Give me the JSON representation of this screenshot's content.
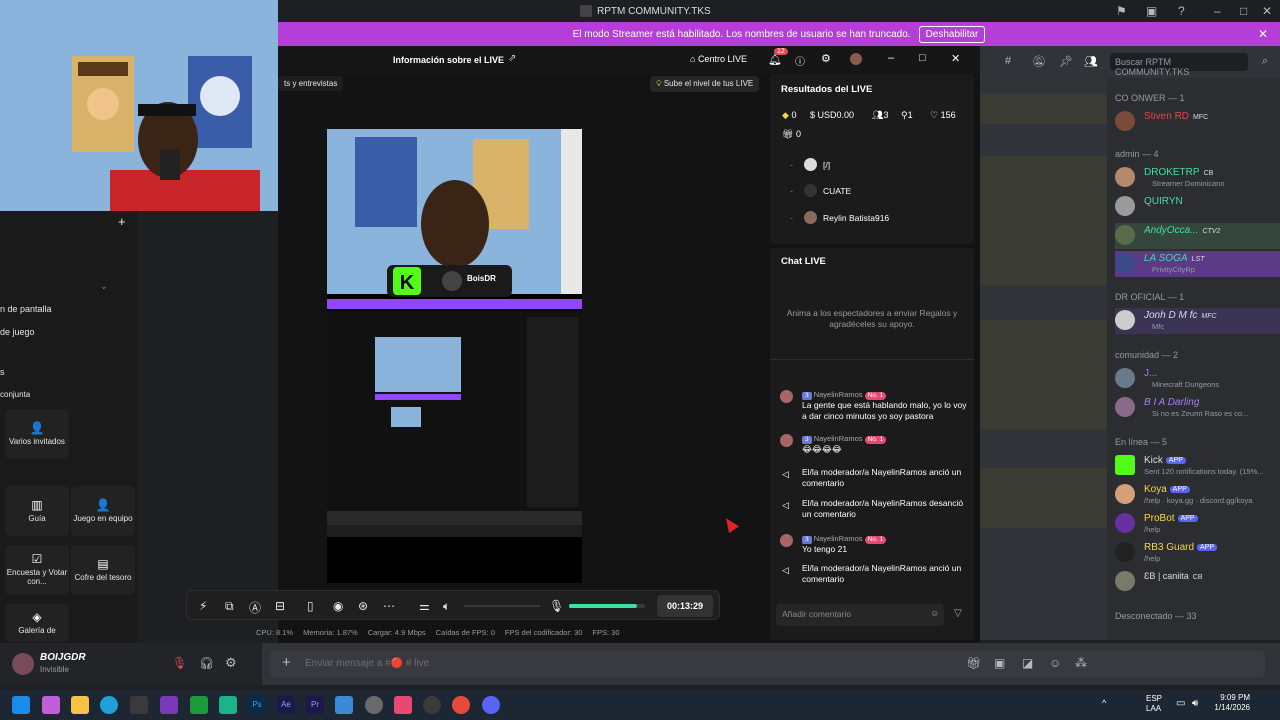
{
  "window": {
    "title": "RPTM COMMUNITY.TKS"
  },
  "banner": {
    "text": "El modo Streamer está habilitado. Los nombres de usuario se han truncado.",
    "button": "Deshabilitar"
  },
  "studio": {
    "header_title": "Información sobre el LIVE",
    "center_live": "Centro LIVE",
    "notif_count": "12",
    "tag_text": "ts y entrevistas",
    "level_tip": "Sube el nivel de tus LIVE",
    "timer": "00:13:29",
    "volume_level": 0.9,
    "preview_user": "BoisDR"
  },
  "left_panel": {
    "items": [
      "n de pantalla",
      "de juego",
      "s",
      "conjunta"
    ],
    "tiles": [
      {
        "label": "Varios invitados",
        "icon": "users-icon"
      },
      {
        "label": "Guía",
        "icon": "book-icon"
      },
      {
        "label": "Juego en equipo",
        "icon": "team-icon"
      },
      {
        "label": "Encuesta y Votar con...",
        "icon": "poll-icon"
      },
      {
        "label": "Cofre del tesoro",
        "icon": "chest-icon"
      },
      {
        "label": "Galería de",
        "icon": "gallery-icon"
      }
    ]
  },
  "stats_bar": {
    "cpu": "CPU: 8.1%",
    "mem": "Memoria: 1.87%",
    "load": "Cargar: 4.9 Mbps",
    "fps_drop": "Caídas de FPS: 0",
    "enc_fps": "FPS del codificador: 30",
    "fps": "FPS: 30"
  },
  "results": {
    "title": "Resultados del LIVE",
    "diamonds": "0",
    "usd": "USD0.00",
    "viewers": "3",
    "shares": "1",
    "likes": "156",
    "gifts": "0",
    "viewers_list": [
      "[/]",
      "CUATE",
      "Reylin Batista916"
    ]
  },
  "chat": {
    "title": "Chat LIVE",
    "empty_text": "Anima a los espectadores a enviar Regalos y agradéceles su apoyo.",
    "messages": [
      {
        "name": "NayelinRamos",
        "level": "3",
        "rank": "No. 1",
        "text": "La gente que está hablando malo, yo lo voy a dar cinco minutos yo soy pastora"
      },
      {
        "name": "NayelinRamos",
        "level": "3",
        "rank": "No. 1",
        "text": "😂😂😂😂"
      },
      {
        "system": "El/la moderador/a NayelinRamos anció un comentario"
      },
      {
        "system": "El/la moderador/a NayelinRamos desanció un comentario"
      },
      {
        "name": "NayelinRamos",
        "level": "3",
        "rank": "No. 1",
        "text": "Yo tengo 21"
      },
      {
        "system": "El/la moderador/a NayelinRamos anció un comentario"
      }
    ],
    "input_placeholder": "Añadir comentario"
  },
  "discord": {
    "search_placeholder": "Buscar RPTM COMMUNITY.TKS",
    "categories": {
      "owner": "CO ONWER — 1",
      "admin": "admin — 4",
      "drof": "DR OFICIAL — 1",
      "comunidad": "comunidad — 2",
      "online": "En línea — 5",
      "offline": "Desconectado — 33"
    },
    "members": {
      "owner1": {
        "name": "Stiven RD",
        "tag": "MFC"
      },
      "admin1": {
        "name": "DROKETRP",
        "tag": "CB",
        "status": "Streamer Dominicano"
      },
      "admin2": {
        "name": "QUIRYN",
        "status": ""
      },
      "admin3": {
        "name": "AndyOcca...",
        "tag": "CTV2"
      },
      "admin4": {
        "name": "LA SOGA",
        "tag": "LST",
        "status": "PrivityCityRp"
      },
      "drof1": {
        "name": "Jonh D M fc",
        "tag": "MFC",
        "status": "Mfc"
      },
      "com1": {
        "name": "J...",
        "status": "Minecraft Dungeons"
      },
      "com2": {
        "name": "B I A Darling",
        "status": "Si no es Zeumt Raso es co..."
      },
      "on1": {
        "name": "Kick",
        "app": "APP",
        "status": "Sent 120 notifications today. (15%..."
      },
      "on2": {
        "name": "Koya",
        "app": "APP",
        "status": "/help · koya.gg · discord.gg/koya"
      },
      "on3": {
        "name": "ProBot",
        "app": "APP",
        "status": "/help"
      },
      "on4": {
        "name": "RB3 Guard",
        "app": "APP",
        "status": "/help"
      },
      "on5": {
        "name": "ƐB | caniita",
        "tag": "CB"
      }
    },
    "user": {
      "name": "BOIJGDR",
      "status": "Invisible"
    },
    "message_placeholder": "Enviar mensaje a #🔴 # live"
  },
  "taskbar": {
    "lang1": "ESP",
    "lang2": "LAA",
    "time": "9:09 PM",
    "date": "1/14/2026"
  }
}
